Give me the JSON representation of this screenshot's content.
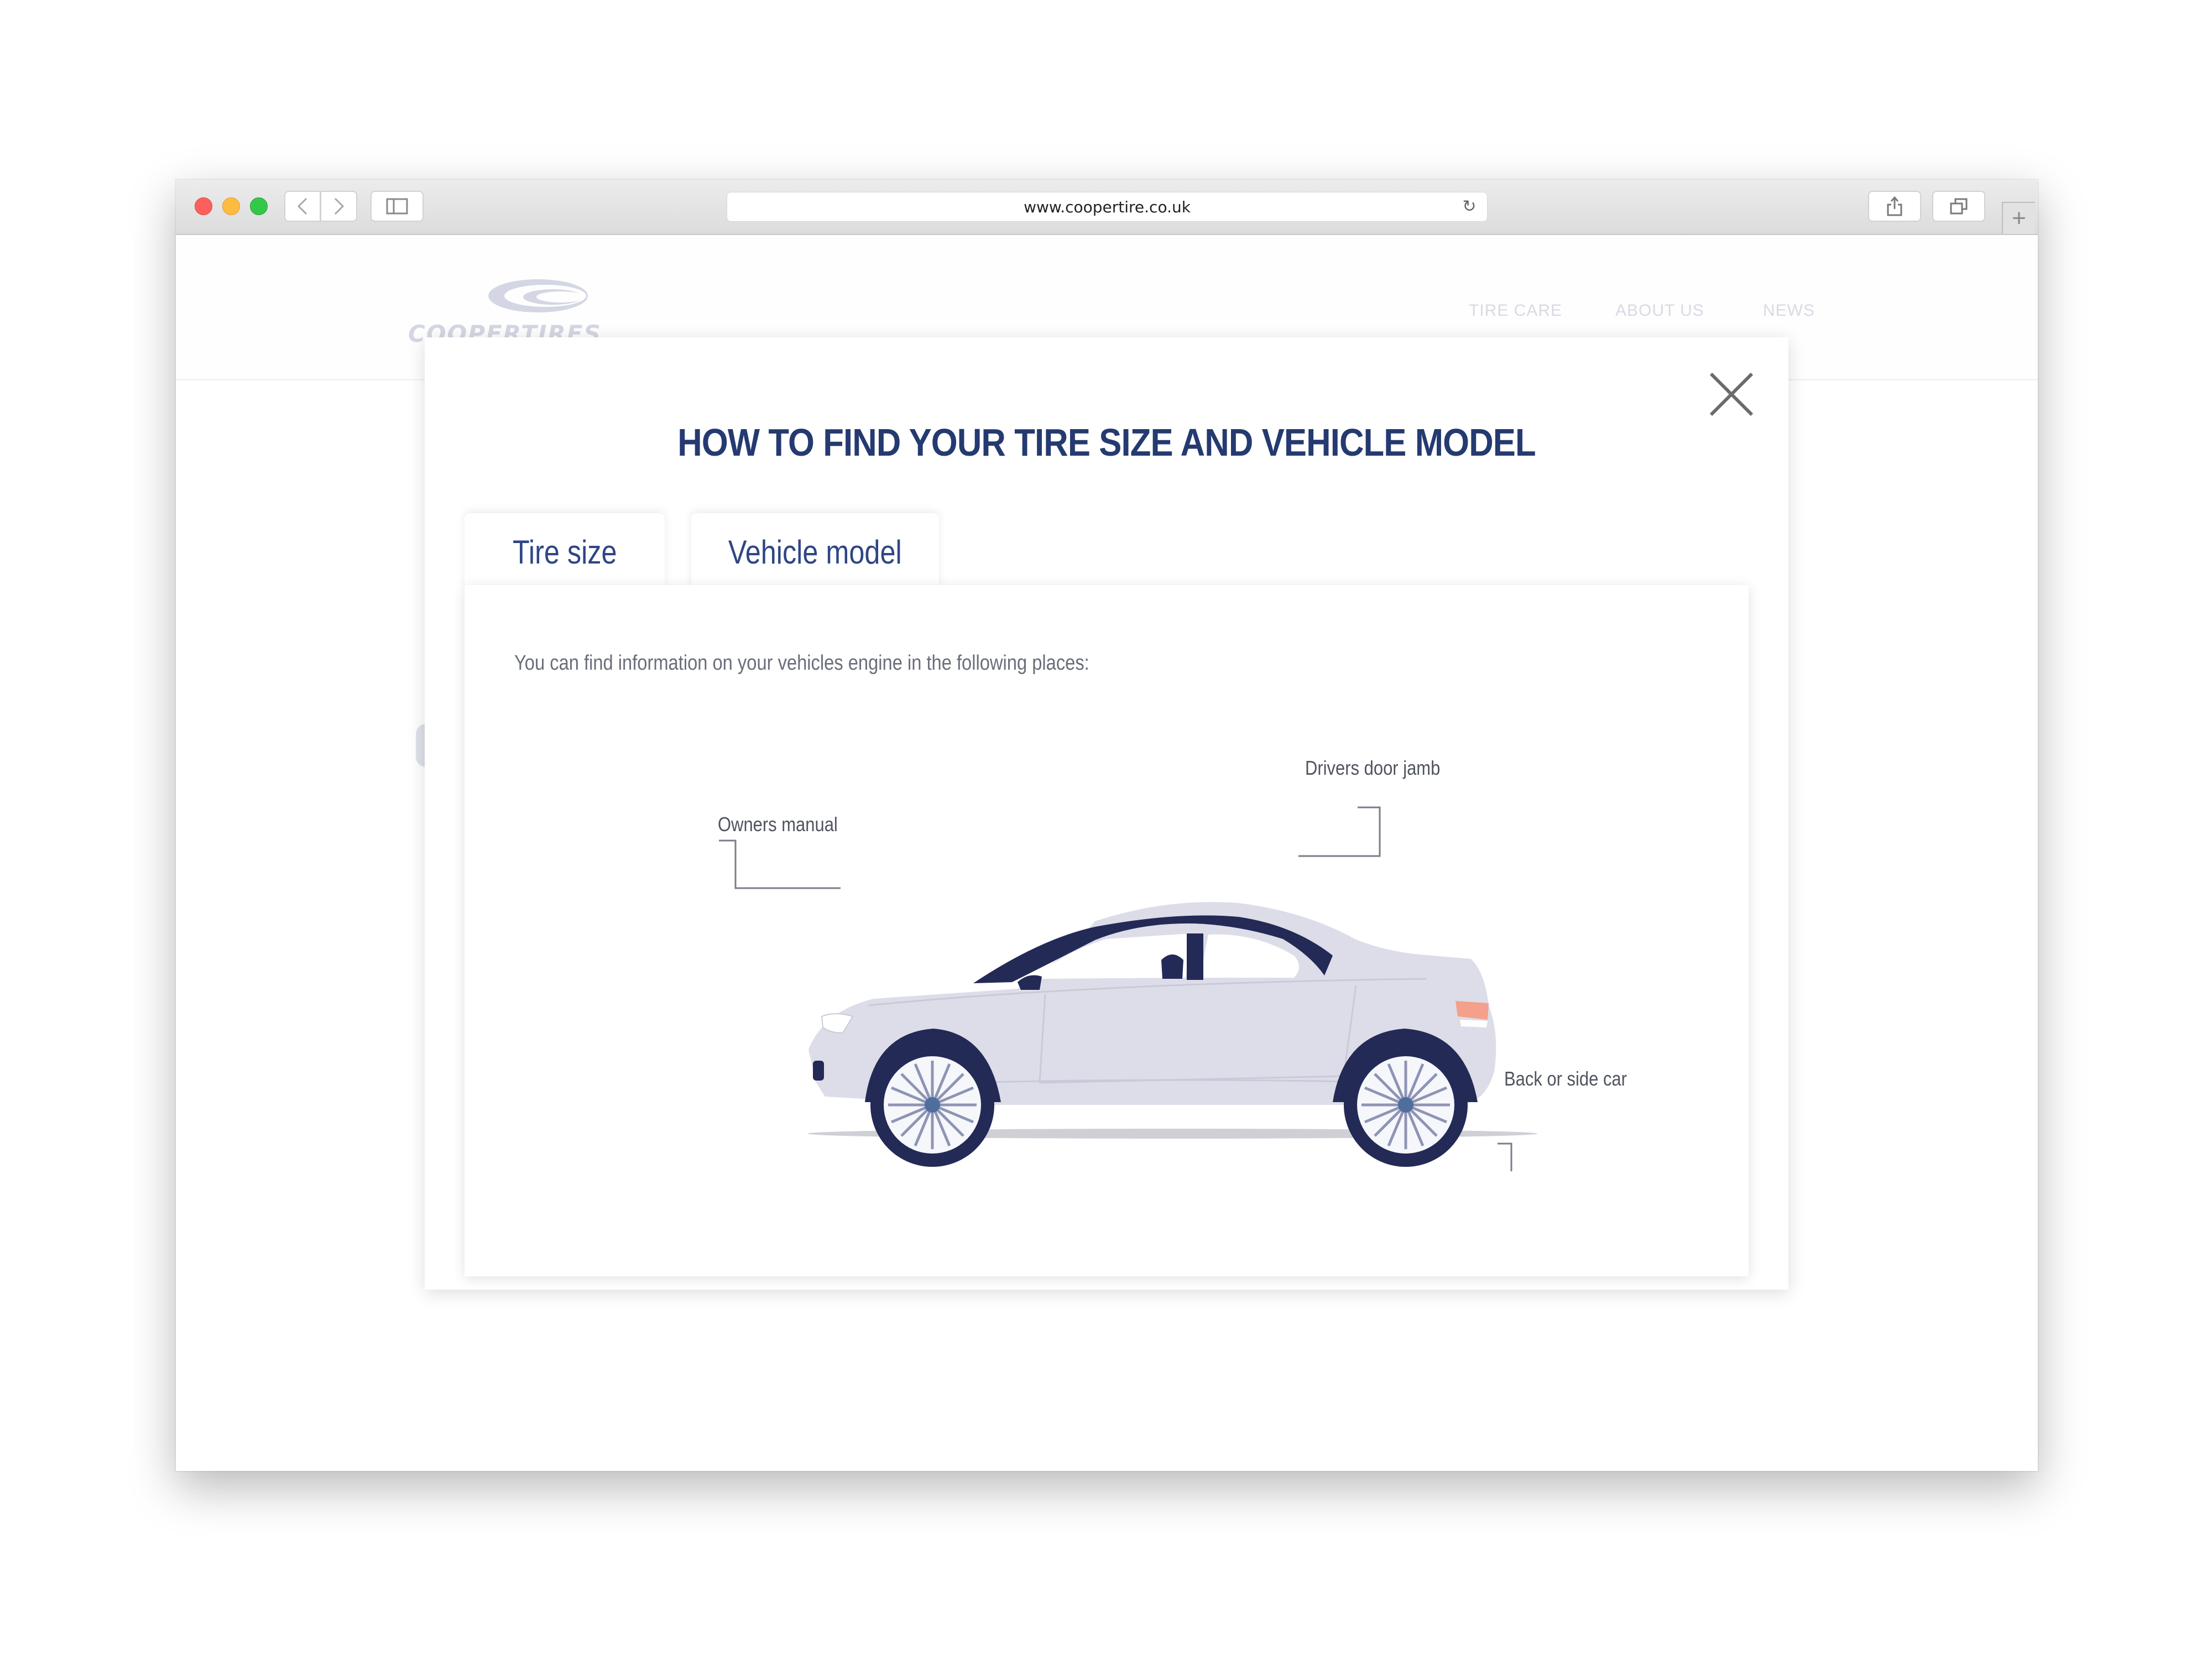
{
  "browser": {
    "url": "www.coopertire.co.uk",
    "icons": {
      "back": "chevron-left-icon",
      "forward": "chevron-right-icon",
      "sidebar": "sidebar-icon",
      "reload": "reload-icon",
      "share": "share-icon",
      "tabs": "tabs-icon",
      "new_tab": "plus-icon"
    }
  },
  "site": {
    "logo_text": "COOPERTIRES",
    "nav": [
      "TIRE CARE",
      "ABOUT US",
      "NEWS"
    ]
  },
  "modal": {
    "title": "HOW TO FIND YOUR TIRE SIZE AND VEHICLE MODEL",
    "close_icon": "close-icon",
    "tabs": [
      {
        "label": "Tire size",
        "active": false
      },
      {
        "label": "Vehicle model",
        "active": true
      }
    ],
    "intro": "You can find information on your vehicles engine in the following places:",
    "callouts": {
      "owners_manual": "Owners manual",
      "drivers_door_jamb": "Drivers door jamb",
      "back_or_side_car": "Back or side car"
    }
  },
  "colors": {
    "title_blue": "#243a70",
    "tab_blue": "#2f4585",
    "car_body": "#dcdde8",
    "car_window": "#232a56",
    "tail_light": "#f4a08a",
    "logo_faded": "#d4d7e3"
  }
}
